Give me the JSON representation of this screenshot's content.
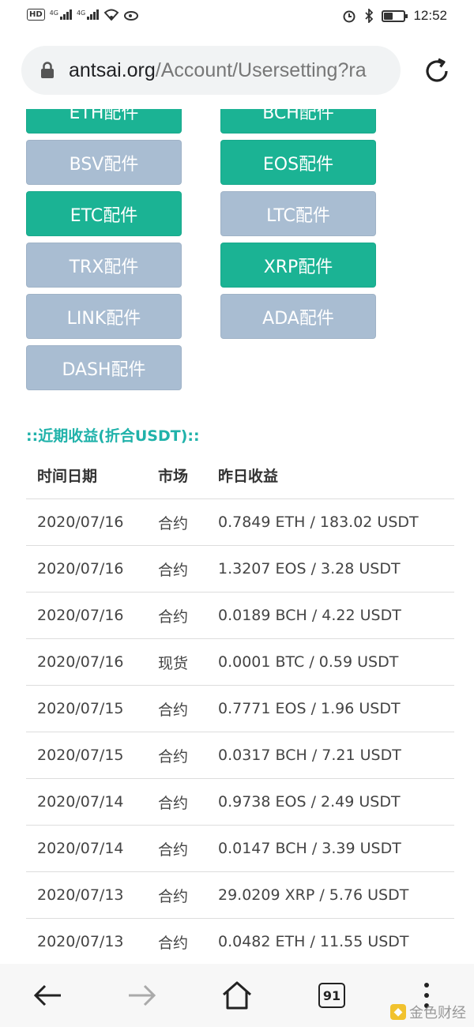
{
  "status_bar": {
    "time": "12:52",
    "hd": "HD",
    "network1": "4G",
    "network2": "4G"
  },
  "browser": {
    "url_host": "antsai.org",
    "url_path": "/Account/Usersetting?ra"
  },
  "plugins": [
    {
      "label": "ETH配件",
      "state": "active"
    },
    {
      "label": "BCH配件",
      "state": "active"
    },
    {
      "label": "BSV配件",
      "state": "inactive"
    },
    {
      "label": "EOS配件",
      "state": "active"
    },
    {
      "label": "ETC配件",
      "state": "active"
    },
    {
      "label": "LTC配件",
      "state": "inactive"
    },
    {
      "label": "TRX配件",
      "state": "inactive"
    },
    {
      "label": "XRP配件",
      "state": "active"
    },
    {
      "label": "LINK配件",
      "state": "inactive"
    },
    {
      "label": "ADA配件",
      "state": "inactive"
    },
    {
      "label": "DASH配件",
      "state": "inactive"
    }
  ],
  "earnings": {
    "title": "::近期收益(折合USDT)::",
    "headers": [
      "时间日期",
      "市场",
      "昨日收益"
    ],
    "rows": [
      [
        "2020/07/16",
        "合约",
        "0.7849 ETH / 183.02 USDT"
      ],
      [
        "2020/07/16",
        "合约",
        "1.3207 EOS / 3.28 USDT"
      ],
      [
        "2020/07/16",
        "合约",
        "0.0189 BCH / 4.22 USDT"
      ],
      [
        "2020/07/16",
        "现货",
        "0.0001 BTC / 0.59 USDT"
      ],
      [
        "2020/07/15",
        "合约",
        "0.7771 EOS / 1.96 USDT"
      ],
      [
        "2020/07/15",
        "合约",
        "0.0317 BCH / 7.21 USDT"
      ],
      [
        "2020/07/14",
        "合约",
        "0.9738 EOS / 2.49 USDT"
      ],
      [
        "2020/07/14",
        "合约",
        "0.0147 BCH / 3.39 USDT"
      ],
      [
        "2020/07/13",
        "合约",
        "29.0209 XRP / 5.76 USDT"
      ],
      [
        "2020/07/13",
        "合约",
        "0.0482 ETH / 11.55 USDT"
      ]
    ]
  },
  "bottom_nav": {
    "tab_count": "91",
    "watermark": "金色财经"
  },
  "colors": {
    "active": "#1bb394",
    "inactive": "#a9bdd2",
    "title": "#20b2aa"
  }
}
